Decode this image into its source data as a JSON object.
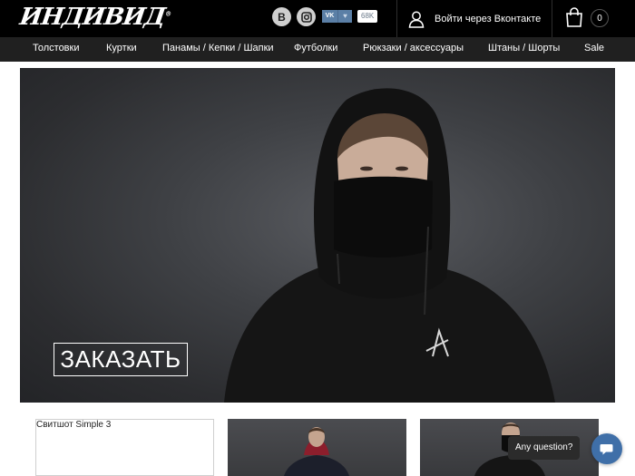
{
  "header": {
    "logo_text": "ИНДИВИД",
    "logo_mark": "®",
    "social": [
      {
        "label": "B",
        "icon": "vk-circle-icon"
      },
      {
        "label": "",
        "icon": "instagram-icon"
      }
    ],
    "vk_like": {
      "vk_label": "VK",
      "heart": "♥",
      "count": "68K"
    },
    "login_label": "Войти через Вконтакте",
    "cart_count": "0"
  },
  "nav": {
    "items": [
      {
        "label": "Толстовки"
      },
      {
        "label": "Куртки"
      },
      {
        "label": "Панамы / Кепки / Шапки"
      },
      {
        "label": "Футболки"
      },
      {
        "label": "Рюкзаки / аксессуары"
      },
      {
        "label": "Штаны / Шорты"
      },
      {
        "label": "Sale"
      }
    ]
  },
  "hero": {
    "order_button": "ЗАКАЗАТЬ"
  },
  "products": [
    {
      "title": "Свитшот Simple 3"
    }
  ],
  "chat": {
    "prompt": "Any question?"
  },
  "colors": {
    "header_bg": "#000000",
    "nav_bg": "#202020",
    "chat_accent": "#3f6fa8"
  }
}
